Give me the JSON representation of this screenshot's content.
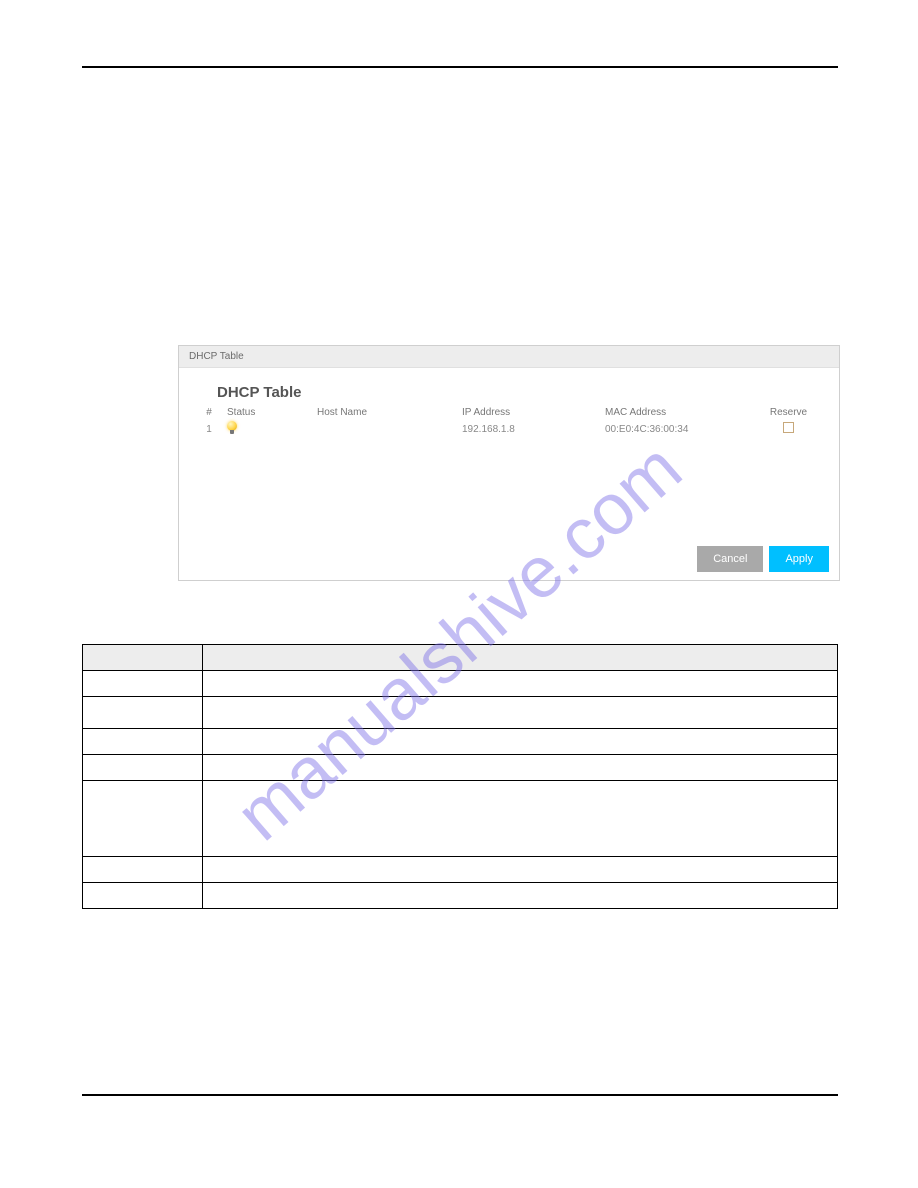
{
  "watermark": {
    "text": "manualshive.com"
  },
  "figure": {
    "header": "DHCP Table",
    "title": "DHCP Table",
    "columns": {
      "idx": "#",
      "status": "Status",
      "host": "Host Name",
      "ip": "IP Address",
      "mac": "MAC Address",
      "reserve": "Reserve"
    },
    "rows": [
      {
        "idx": "1",
        "status_icon": "lightbulb-on",
        "host": "",
        "ip": "192.168.1.8",
        "mac": "00:E0:4C:36:00:34",
        "reserve_checked": false
      }
    ],
    "buttons": {
      "cancel": "Cancel",
      "apply": "Apply"
    }
  },
  "desc_table": {
    "header": {
      "label": "",
      "description": ""
    },
    "rows": [
      {
        "label": "",
        "description": ""
      },
      {
        "label": "",
        "description": ""
      },
      {
        "label": "",
        "description": ""
      },
      {
        "label": "",
        "description": ""
      },
      {
        "label": "",
        "description": ""
      },
      {
        "label": "",
        "description": ""
      },
      {
        "label": "",
        "description": ""
      }
    ]
  }
}
